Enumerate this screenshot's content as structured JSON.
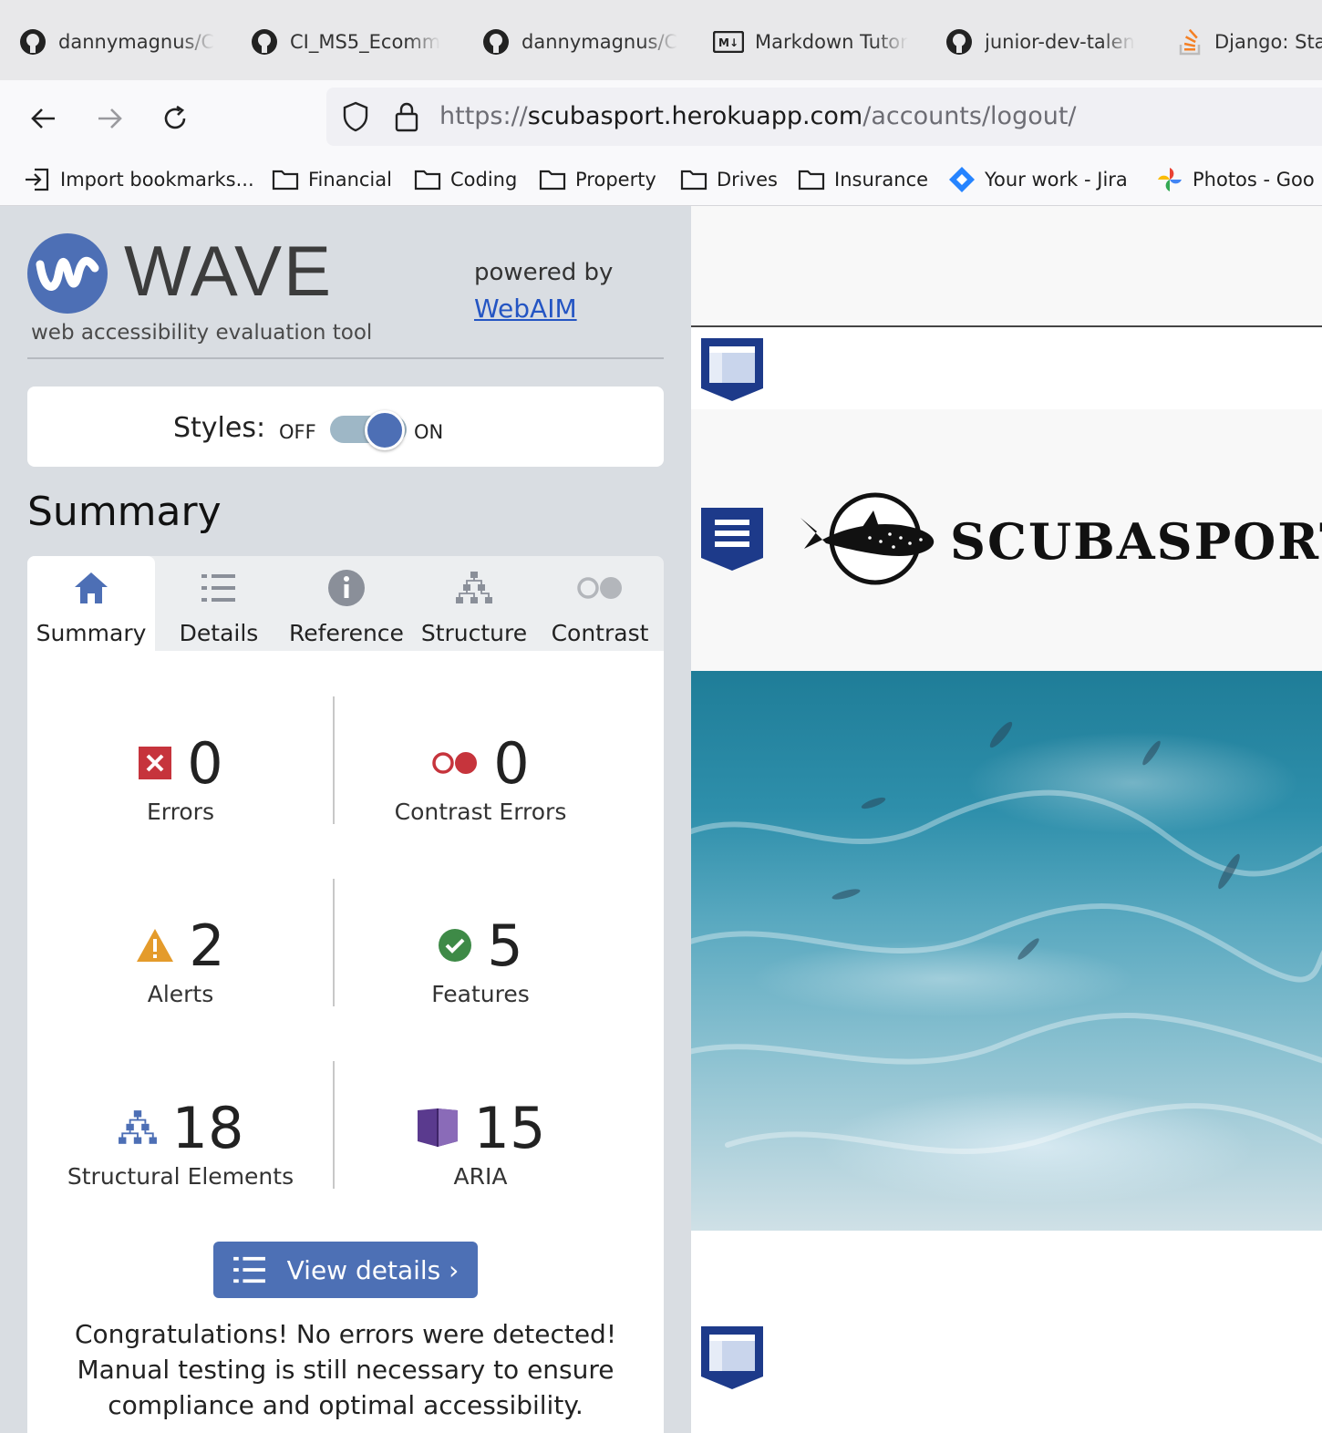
{
  "browser": {
    "tabs": [
      {
        "label": "dannymagnus/C",
        "icon": "github-icon"
      },
      {
        "label": "CI_MS5_Ecomm",
        "icon": "github-icon"
      },
      {
        "label": "dannymagnus/C",
        "icon": "github-icon"
      },
      {
        "label": "Markdown Tutor",
        "icon": "markdown-icon"
      },
      {
        "label": "junior-dev-talen",
        "icon": "github-icon"
      },
      {
        "label": "Django: Sta",
        "icon": "stackoverflow-icon"
      }
    ],
    "url": {
      "scheme": "https://",
      "host": "scubasport.herokuapp.com",
      "path": "/accounts/logout/"
    },
    "bookmarks": [
      {
        "label": "Import bookmarks...",
        "icon": "import-icon"
      },
      {
        "label": "Financial",
        "icon": "folder-icon"
      },
      {
        "label": "Coding",
        "icon": "folder-icon"
      },
      {
        "label": "Property",
        "icon": "folder-icon"
      },
      {
        "label": "Drives",
        "icon": "folder-icon"
      },
      {
        "label": "Insurance",
        "icon": "folder-icon"
      },
      {
        "label": "Your work - Jira",
        "icon": "jira-icon"
      },
      {
        "label": "Photos - Goo",
        "icon": "google-photos-icon"
      }
    ]
  },
  "wave": {
    "title": "WAVE",
    "subtitle": "web accessibility evaluation tool",
    "powered_by": "powered by",
    "webaim": "WebAIM",
    "styles": {
      "label": "Styles:",
      "off": "OFF",
      "on": "ON",
      "state": "on"
    },
    "heading": "Summary",
    "tabs": [
      {
        "label": "Summary",
        "icon": "home-icon",
        "active": true
      },
      {
        "label": "Details",
        "icon": "list-icon",
        "active": false
      },
      {
        "label": "Reference",
        "icon": "info-icon",
        "active": false
      },
      {
        "label": "Structure",
        "icon": "structure-icon",
        "active": false
      },
      {
        "label": "Contrast",
        "icon": "contrast-icon",
        "active": false
      }
    ],
    "stats": {
      "errors": {
        "value": "0",
        "label": "Errors",
        "color": "#c6343c"
      },
      "contrast_errors": {
        "value": "0",
        "label": "Contrast Errors",
        "color": "#c6343c"
      },
      "alerts": {
        "value": "2",
        "label": "Alerts",
        "color": "#e49b2b"
      },
      "features": {
        "value": "5",
        "label": "Features",
        "color": "#3e8a47"
      },
      "structural": {
        "value": "18",
        "label": "Structural Elements",
        "color": "#4d6fb5"
      },
      "aria": {
        "value": "15",
        "label": "ARIA",
        "color": "#5a3a8e"
      }
    },
    "view_details": "View details ›",
    "message": "Congratulations! No errors were detected! Manual testing is still necessary to ensure compliance and optimal accessibility."
  },
  "preview": {
    "brand": "SCUBASPORT"
  },
  "colors": {
    "wave_blue": "#4d6fb5",
    "sidebar_bg": "#d9dde2",
    "aria_badge": "#1d3a8a"
  }
}
